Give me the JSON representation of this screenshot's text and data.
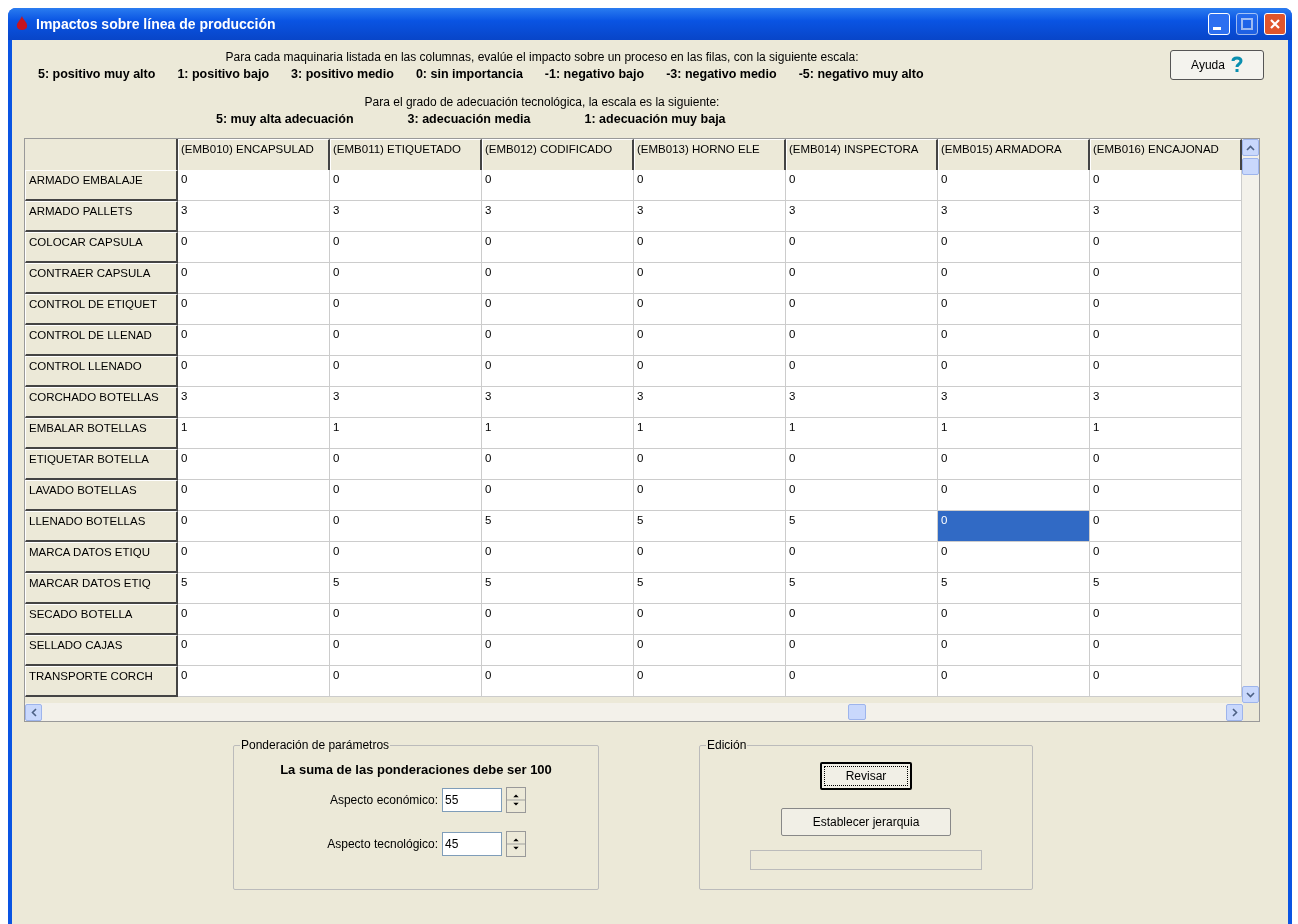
{
  "window": {
    "title": "Impactos sobre línea de producción"
  },
  "instructions": {
    "impact_intro": "Para cada maquinaria listada en las columnas, evalúe el impacto sobre un proceso en las filas, con la siguiente escala:",
    "impact_scale": [
      "5: positivo muy alto",
      "1: positivo bajo",
      "3: positivo medio",
      "0: sin importancia",
      "-1: negativo bajo",
      "-3: negativo medio",
      "-5: negativo muy alto"
    ],
    "tech_intro": "Para el  grado de adecuación tecnológica, la escala es la siguiente:",
    "tech_scale": [
      "5: muy alta adecuación",
      "3: adecuación media",
      "1: adecuación muy baja"
    ]
  },
  "help_button": {
    "label": "Ayuda"
  },
  "table": {
    "columns": [
      "(EMB010) ENCAPSULAD",
      "(EMB011) ETIQUETADO",
      "(EMB012) CODIFICADO",
      "(EMB013) HORNO ELE",
      "(EMB014) INSPECTORA",
      "(EMB015) ARMADORA",
      "(EMB016) ENCAJONAD"
    ],
    "rows": [
      {
        "label": "ARMADO EMBALAJE",
        "cells": [
          {
            "value": "0",
            "selected": false
          },
          {
            "value": "0",
            "selected": false
          },
          {
            "value": "0",
            "selected": false
          },
          {
            "value": "0",
            "selected": false
          },
          {
            "value": "0",
            "selected": false
          },
          {
            "value": "0",
            "selected": false
          },
          {
            "value": "0",
            "selected": false
          }
        ]
      },
      {
        "label": "ARMADO PALLETS",
        "cells": [
          {
            "value": "3",
            "selected": false
          },
          {
            "value": "3",
            "selected": false
          },
          {
            "value": "3",
            "selected": false
          },
          {
            "value": "3",
            "selected": false
          },
          {
            "value": "3",
            "selected": false
          },
          {
            "value": "3",
            "selected": false
          },
          {
            "value": "3",
            "selected": false
          }
        ]
      },
      {
        "label": "COLOCAR CAPSULA",
        "cells": [
          {
            "value": "0",
            "selected": false
          },
          {
            "value": "0",
            "selected": false
          },
          {
            "value": "0",
            "selected": false
          },
          {
            "value": "0",
            "selected": false
          },
          {
            "value": "0",
            "selected": false
          },
          {
            "value": "0",
            "selected": false
          },
          {
            "value": "0",
            "selected": false
          }
        ]
      },
      {
        "label": "CONTRAER CAPSULA",
        "cells": [
          {
            "value": "0",
            "selected": false
          },
          {
            "value": "0",
            "selected": false
          },
          {
            "value": "0",
            "selected": false
          },
          {
            "value": "0",
            "selected": false
          },
          {
            "value": "0",
            "selected": false
          },
          {
            "value": "0",
            "selected": false
          },
          {
            "value": "0",
            "selected": false
          }
        ]
      },
      {
        "label": "CONTROL DE ETIQUET",
        "cells": [
          {
            "value": "0",
            "selected": false
          },
          {
            "value": "0",
            "selected": false
          },
          {
            "value": "0",
            "selected": false
          },
          {
            "value": "0",
            "selected": false
          },
          {
            "value": "0",
            "selected": false
          },
          {
            "value": "0",
            "selected": false
          },
          {
            "value": "0",
            "selected": false
          }
        ]
      },
      {
        "label": "CONTROL DE LLENAD",
        "cells": [
          {
            "value": "0",
            "selected": false
          },
          {
            "value": "0",
            "selected": false
          },
          {
            "value": "0",
            "selected": false
          },
          {
            "value": "0",
            "selected": false
          },
          {
            "value": "0",
            "selected": false
          },
          {
            "value": "0",
            "selected": false
          },
          {
            "value": "0",
            "selected": false
          }
        ]
      },
      {
        "label": "CONTROL LLENADO",
        "cells": [
          {
            "value": "0",
            "selected": false
          },
          {
            "value": "0",
            "selected": false
          },
          {
            "value": "0",
            "selected": false
          },
          {
            "value": "0",
            "selected": false
          },
          {
            "value": "0",
            "selected": false
          },
          {
            "value": "0",
            "selected": false
          },
          {
            "value": "0",
            "selected": false
          }
        ]
      },
      {
        "label": "CORCHADO BOTELLAS",
        "cells": [
          {
            "value": "3",
            "selected": false
          },
          {
            "value": "3",
            "selected": false
          },
          {
            "value": "3",
            "selected": false
          },
          {
            "value": "3",
            "selected": false
          },
          {
            "value": "3",
            "selected": false
          },
          {
            "value": "3",
            "selected": false
          },
          {
            "value": "3",
            "selected": false
          }
        ]
      },
      {
        "label": "EMBALAR BOTELLAS",
        "cells": [
          {
            "value": "1",
            "selected": false
          },
          {
            "value": "1",
            "selected": false
          },
          {
            "value": "1",
            "selected": false
          },
          {
            "value": "1",
            "selected": false
          },
          {
            "value": "1",
            "selected": false
          },
          {
            "value": "1",
            "selected": false
          },
          {
            "value": "1",
            "selected": false
          }
        ]
      },
      {
        "label": "ETIQUETAR BOTELLA",
        "cells": [
          {
            "value": "0",
            "selected": false
          },
          {
            "value": "0",
            "selected": false
          },
          {
            "value": "0",
            "selected": false
          },
          {
            "value": "0",
            "selected": false
          },
          {
            "value": "0",
            "selected": false
          },
          {
            "value": "0",
            "selected": false
          },
          {
            "value": "0",
            "selected": false
          }
        ]
      },
      {
        "label": "LAVADO BOTELLAS",
        "cells": [
          {
            "value": "0",
            "selected": false
          },
          {
            "value": "0",
            "selected": false
          },
          {
            "value": "0",
            "selected": false
          },
          {
            "value": "0",
            "selected": false
          },
          {
            "value": "0",
            "selected": false
          },
          {
            "value": "0",
            "selected": false
          },
          {
            "value": "0",
            "selected": false
          }
        ]
      },
      {
        "label": "LLENADO BOTELLAS",
        "cells": [
          {
            "value": "0",
            "selected": false
          },
          {
            "value": "0",
            "selected": false
          },
          {
            "value": "5",
            "selected": false
          },
          {
            "value": "5",
            "selected": false
          },
          {
            "value": "5",
            "selected": false
          },
          {
            "value": "0",
            "selected": true
          },
          {
            "value": "0",
            "selected": false
          }
        ]
      },
      {
        "label": "MARCA DATOS ETIQU",
        "cells": [
          {
            "value": "0",
            "selected": false
          },
          {
            "value": "0",
            "selected": false
          },
          {
            "value": "0",
            "selected": false
          },
          {
            "value": "0",
            "selected": false
          },
          {
            "value": "0",
            "selected": false
          },
          {
            "value": "0",
            "selected": false
          },
          {
            "value": "0",
            "selected": false
          }
        ]
      },
      {
        "label": "MARCAR DATOS ETIQ",
        "cells": [
          {
            "value": "5",
            "selected": false
          },
          {
            "value": "5",
            "selected": false
          },
          {
            "value": "5",
            "selected": false
          },
          {
            "value": "5",
            "selected": false
          },
          {
            "value": "5",
            "selected": false
          },
          {
            "value": "5",
            "selected": false
          },
          {
            "value": "5",
            "selected": false
          }
        ]
      },
      {
        "label": "SECADO BOTELLA",
        "cells": [
          {
            "value": "0",
            "selected": false
          },
          {
            "value": "0",
            "selected": false
          },
          {
            "value": "0",
            "selected": false
          },
          {
            "value": "0",
            "selected": false
          },
          {
            "value": "0",
            "selected": false
          },
          {
            "value": "0",
            "selected": false
          },
          {
            "value": "0",
            "selected": false
          }
        ]
      },
      {
        "label": "SELLADO CAJAS",
        "cells": [
          {
            "value": "0",
            "selected": false
          },
          {
            "value": "0",
            "selected": false
          },
          {
            "value": "0",
            "selected": false
          },
          {
            "value": "0",
            "selected": false
          },
          {
            "value": "0",
            "selected": false
          },
          {
            "value": "0",
            "selected": false
          },
          {
            "value": "0",
            "selected": false
          }
        ]
      },
      {
        "label": "TRANSPORTE CORCH",
        "cells": [
          {
            "value": "0",
            "selected": false
          },
          {
            "value": "0",
            "selected": false
          },
          {
            "value": "0",
            "selected": false
          },
          {
            "value": "0",
            "selected": false
          },
          {
            "value": "0",
            "selected": false
          },
          {
            "value": "0",
            "selected": false
          },
          {
            "value": "0",
            "selected": false
          }
        ]
      }
    ]
  },
  "weighting": {
    "title": "Ponderación de parámetros",
    "note": "La suma de las ponderaciones debe ser 100",
    "fields": [
      {
        "label": "Aspecto económico:",
        "value": "55"
      },
      {
        "label": "Aspecto tecnológico:",
        "value": "45"
      }
    ]
  },
  "editing": {
    "title": "Edición",
    "buttons": [
      {
        "label": "Revisar",
        "focused": true
      },
      {
        "label": "Establecer jerarquia",
        "focused": false
      }
    ],
    "progress": {
      "level": 0
    }
  }
}
